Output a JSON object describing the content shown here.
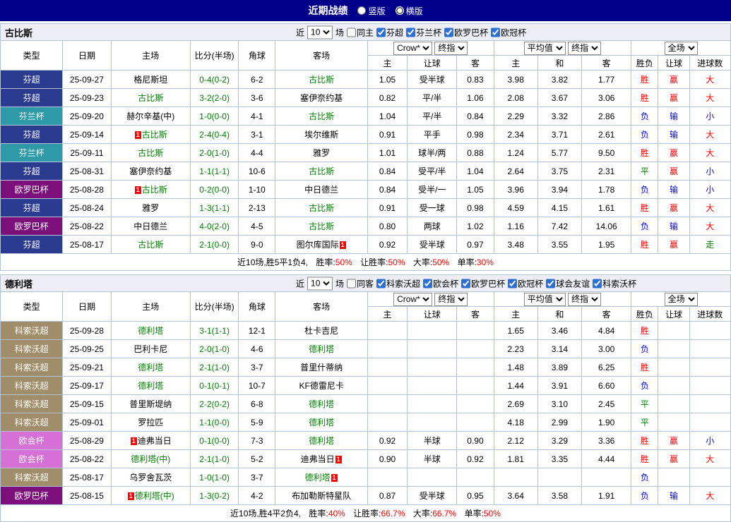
{
  "title_bar": {
    "title": "近期战绩",
    "radio_vertical": "竖版",
    "radio_horizontal": "横版",
    "vertical_checked": false,
    "horizontal_checked": true
  },
  "card_badge": "1",
  "colors": {
    "topbar_bg": "#00008b",
    "focus_team": "#008000",
    "score": "#008000",
    "value_red": "#ff0000",
    "card_red": "#ff0000",
    "league": {
      "芬超": "#2b3b8f",
      "芬兰杯": "#2e9aa8",
      "欧罗巴杯": "#7c0f7c",
      "科索沃超": "#a08e6a",
      "欧会杯": "#d66fd6"
    },
    "result": {
      "胜": "#ff0000",
      "平": "#008000",
      "负": "#0000ee",
      "赢": "#ff0000",
      "输": "#0000ee",
      "大": "#ff0000",
      "小": "#0000ee",
      "走": "#008000"
    }
  },
  "tables": [
    {
      "team": "古比斯",
      "filter": {
        "recent_label": "近",
        "recent_value": "10",
        "games_label": "场",
        "same_label": "同主",
        "same_checked": false,
        "leagues": [
          {
            "label": "芬超",
            "checked": true
          },
          {
            "label": "芬兰杯",
            "checked": true
          },
          {
            "label": "欧罗巴杯",
            "checked": true
          },
          {
            "label": "欧冠杯",
            "checked": true
          }
        ]
      },
      "header": {
        "cols": [
          "类型",
          "日期",
          "主场",
          "比分(半场)",
          "角球",
          "客场"
        ],
        "book_select": "Crow*",
        "stage_select": "终指",
        "avg_select": "平均值",
        "avg_stage_select": "终指",
        "full_select": "全场",
        "odds_sub": [
          "主",
          "让球",
          "客"
        ],
        "avg_sub": [
          "主",
          "和",
          "客"
        ],
        "result_sub": [
          "胜负",
          "让球",
          "进球数"
        ]
      },
      "rows": [
        {
          "league": "芬超",
          "date": "25-09-27",
          "home": {
            "n": "格尼斯坦"
          },
          "score": "0-4(0-2)",
          "corner": "6-2",
          "away": {
            "n": "古比斯",
            "f": 1
          },
          "o": [
            "1.05",
            "受半球",
            "0.83"
          ],
          "a": [
            "3.98",
            "3.82",
            "1.77"
          ],
          "r": [
            "胜",
            "赢",
            "大"
          ]
        },
        {
          "league": "芬超",
          "date": "25-09-23",
          "home": {
            "n": "古比斯",
            "f": 1
          },
          "score": "3-2(2-0)",
          "corner": "3-6",
          "away": {
            "n": "塞伊奈约基"
          },
          "o": [
            "0.82",
            "平/半",
            "1.06"
          ],
          "a": [
            "2.08",
            "3.67",
            "3.06"
          ],
          "r": [
            "胜",
            "赢",
            "大"
          ]
        },
        {
          "league": "芬兰杯",
          "date": "25-09-20",
          "home": {
            "n": "赫尔辛基(中)"
          },
          "score": "1-0(0-0)",
          "corner": "4-1",
          "away": {
            "n": "古比斯",
            "f": 1
          },
          "o": [
            "1.04",
            "平/半",
            "0.84"
          ],
          "a": [
            "2.29",
            "3.32",
            "2.86"
          ],
          "r": [
            "负",
            "输",
            "小"
          ]
        },
        {
          "league": "芬超",
          "date": "25-09-14",
          "home": {
            "n": "古比斯",
            "f": 1,
            "c": "pre"
          },
          "score": "2-4(0-4)",
          "corner": "3-1",
          "away": {
            "n": "埃尔维斯"
          },
          "o": [
            "0.91",
            "平手",
            "0.98"
          ],
          "a": [
            "2.34",
            "3.71",
            "2.61"
          ],
          "r": [
            "负",
            "输",
            "大"
          ]
        },
        {
          "league": "芬兰杯",
          "date": "25-09-11",
          "home": {
            "n": "古比斯",
            "f": 1
          },
          "score": "2-0(1-0)",
          "corner": "4-4",
          "away": {
            "n": "雅罗"
          },
          "o": [
            "1.01",
            "球半/两",
            "0.88"
          ],
          "a": [
            "1.24",
            "5.77",
            "9.50"
          ],
          "r": [
            "胜",
            "赢",
            "大"
          ]
        },
        {
          "league": "芬超",
          "date": "25-08-31",
          "home": {
            "n": "塞伊奈约基"
          },
          "score": "1-1(1-1)",
          "corner": "10-6",
          "away": {
            "n": "古比斯",
            "f": 1
          },
          "o": [
            "0.84",
            "受平/半",
            "1.04"
          ],
          "a": [
            "2.64",
            "3.75",
            "2.31"
          ],
          "r": [
            "平",
            "赢",
            "小"
          ]
        },
        {
          "league": "欧罗巴杯",
          "date": "25-08-28",
          "home": {
            "n": "古比斯",
            "f": 1,
            "c": "pre"
          },
          "score": "0-2(0-0)",
          "corner": "1-10",
          "away": {
            "n": "中日德兰"
          },
          "o": [
            "0.84",
            "受半/一",
            "1.05"
          ],
          "a": [
            "3.96",
            "3.94",
            "1.78"
          ],
          "r": [
            "负",
            "输",
            "小"
          ]
        },
        {
          "league": "芬超",
          "date": "25-08-24",
          "home": {
            "n": "雅罗"
          },
          "score": "1-3(1-1)",
          "corner": "2-13",
          "away": {
            "n": "古比斯",
            "f": 1
          },
          "o": [
            "0.91",
            "受一球",
            "0.98"
          ],
          "a": [
            "4.59",
            "4.15",
            "1.61"
          ],
          "r": [
            "胜",
            "赢",
            "大"
          ]
        },
        {
          "league": "欧罗巴杯",
          "date": "25-08-22",
          "home": {
            "n": "中日德兰"
          },
          "score": "4-0(2-0)",
          "corner": "4-5",
          "away": {
            "n": "古比斯",
            "f": 1
          },
          "o": [
            "0.80",
            "两球",
            "1.02"
          ],
          "a": [
            "1.16",
            "7.42",
            "14.06"
          ],
          "r": [
            "负",
            "输",
            "大"
          ]
        },
        {
          "league": "芬超",
          "date": "25-08-17",
          "home": {
            "n": "古比斯",
            "f": 1
          },
          "score": "2-1(0-0)",
          "corner": "9-0",
          "away": {
            "n": "图尔库国际",
            "c": "post"
          },
          "o": [
            "0.92",
            "受半球",
            "0.97"
          ],
          "a": [
            "3.48",
            "3.55",
            "1.95"
          ],
          "r": [
            "胜",
            "赢",
            "走"
          ]
        }
      ],
      "summary": {
        "prefix": "近10场,胜5平1负4,",
        "items": [
          {
            "label": "胜率:",
            "value": "50%"
          },
          {
            "label": "让胜率:",
            "value": "50%"
          },
          {
            "label": "大率:",
            "value": "50%"
          },
          {
            "label": "单率:",
            "value": "30%"
          }
        ]
      }
    },
    {
      "team": "德利塔",
      "filter": {
        "recent_label": "近",
        "recent_value": "10",
        "games_label": "场",
        "same_label": "同客",
        "same_checked": false,
        "leagues": [
          {
            "label": "科索沃超",
            "checked": true
          },
          {
            "label": "欧会杯",
            "checked": true
          },
          {
            "label": "欧罗巴杯",
            "checked": true
          },
          {
            "label": "欧冠杯",
            "checked": true
          },
          {
            "label": "球会友谊",
            "checked": true
          },
          {
            "label": "科索沃杯",
            "checked": true
          }
        ]
      },
      "header": {
        "cols": [
          "类型",
          "日期",
          "主场",
          "比分(半场)",
          "角球",
          "客场"
        ],
        "book_select": "Crow*",
        "stage_select": "终指",
        "avg_select": "平均值",
        "avg_stage_select": "终指",
        "full_select": "全场",
        "odds_sub": [
          "主",
          "让球",
          "客"
        ],
        "avg_sub": [
          "主",
          "和",
          "客"
        ],
        "result_sub": [
          "胜负",
          "让球",
          "进球数"
        ]
      },
      "rows": [
        {
          "league": "科索沃超",
          "date": "25-09-28",
          "home": {
            "n": "德利塔",
            "f": 1
          },
          "score": "3-1(1-1)",
          "corner": "12-1",
          "away": {
            "n": "杜卡吉尼"
          },
          "o": [
            "",
            "",
            ""
          ],
          "a": [
            "1.65",
            "3.46",
            "4.84"
          ],
          "r": [
            "胜",
            "",
            ""
          ]
        },
        {
          "league": "科索沃超",
          "date": "25-09-25",
          "home": {
            "n": "巴利卡尼"
          },
          "score": "2-0(1-0)",
          "corner": "4-6",
          "away": {
            "n": "德利塔",
            "f": 1
          },
          "o": [
            "",
            "",
            ""
          ],
          "a": [
            "2.23",
            "3.14",
            "3.00"
          ],
          "r": [
            "负",
            "",
            ""
          ]
        },
        {
          "league": "科索沃超",
          "date": "25-09-21",
          "home": {
            "n": "德利塔",
            "f": 1
          },
          "score": "2-1(1-0)",
          "corner": "3-7",
          "away": {
            "n": "普里什蒂纳"
          },
          "o": [
            "",
            "",
            ""
          ],
          "a": [
            "1.48",
            "3.89",
            "6.25"
          ],
          "r": [
            "胜",
            "",
            ""
          ]
        },
        {
          "league": "科索沃超",
          "date": "25-09-17",
          "home": {
            "n": "德利塔",
            "f": 1
          },
          "score": "0-1(0-1)",
          "corner": "10-7",
          "away": {
            "n": "KF德雷尼卡"
          },
          "o": [
            "",
            "",
            ""
          ],
          "a": [
            "1.44",
            "3.91",
            "6.60"
          ],
          "r": [
            "负",
            "",
            ""
          ]
        },
        {
          "league": "科索沃超",
          "date": "25-09-15",
          "home": {
            "n": "普里斯堤纳"
          },
          "score": "2-2(0-2)",
          "corner": "6-8",
          "away": {
            "n": "德利塔",
            "f": 1
          },
          "o": [
            "",
            "",
            ""
          ],
          "a": [
            "2.69",
            "3.10",
            "2.45"
          ],
          "r": [
            "平",
            "",
            ""
          ]
        },
        {
          "league": "科索沃超",
          "date": "25-09-01",
          "home": {
            "n": "罗拉匹"
          },
          "score": "1-1(0-0)",
          "corner": "5-9",
          "away": {
            "n": "德利塔",
            "f": 1
          },
          "o": [
            "",
            "",
            ""
          ],
          "a": [
            "4.18",
            "2.99",
            "1.90"
          ],
          "r": [
            "平",
            "",
            ""
          ]
        },
        {
          "league": "欧会杯",
          "date": "25-08-29",
          "home": {
            "n": "迪弗当日",
            "c": "pre"
          },
          "score": "0-1(0-0)",
          "corner": "7-3",
          "away": {
            "n": "德利塔",
            "f": 1
          },
          "o": [
            "0.92",
            "半球",
            "0.90"
          ],
          "a": [
            "2.12",
            "3.29",
            "3.36"
          ],
          "r": [
            "胜",
            "赢",
            "小"
          ]
        },
        {
          "league": "欧会杯",
          "date": "25-08-22",
          "home": {
            "n": "德利塔(中)",
            "f": 1
          },
          "score": "2-1(1-0)",
          "corner": "5-2",
          "away": {
            "n": "迪弗当日",
            "c": "post"
          },
          "o": [
            "0.90",
            "半球",
            "0.92"
          ],
          "a": [
            "1.81",
            "3.35",
            "4.44"
          ],
          "r": [
            "胜",
            "赢",
            "大"
          ]
        },
        {
          "league": "科索沃超",
          "date": "25-08-17",
          "home": {
            "n": "乌罗舍瓦茨"
          },
          "score": "1-0(1-0)",
          "corner": "3-7",
          "away": {
            "n": "德利塔",
            "f": 1,
            "c": "post"
          },
          "o": [
            "",
            "",
            ""
          ],
          "a": [
            "",
            "",
            ""
          ],
          "r": [
            "负",
            "",
            ""
          ]
        },
        {
          "league": "欧罗巴杯",
          "date": "25-08-15",
          "home": {
            "n": "德利塔(中)",
            "f": 1,
            "c": "pre"
          },
          "score": "1-3(0-2)",
          "corner": "4-2",
          "away": {
            "n": "布加勒斯特星队"
          },
          "o": [
            "0.87",
            "受半球",
            "0.95"
          ],
          "a": [
            "3.64",
            "3.58",
            "1.91"
          ],
          "r": [
            "负",
            "输",
            "大"
          ]
        }
      ],
      "summary": {
        "prefix": "近10场,胜4平2负4,",
        "items": [
          {
            "label": "胜率:",
            "value": "40%"
          },
          {
            "label": "让胜率:",
            "value": "66.7%"
          },
          {
            "label": "大率:",
            "value": "66.7%"
          },
          {
            "label": "单率:",
            "value": "50%"
          }
        ]
      }
    }
  ]
}
